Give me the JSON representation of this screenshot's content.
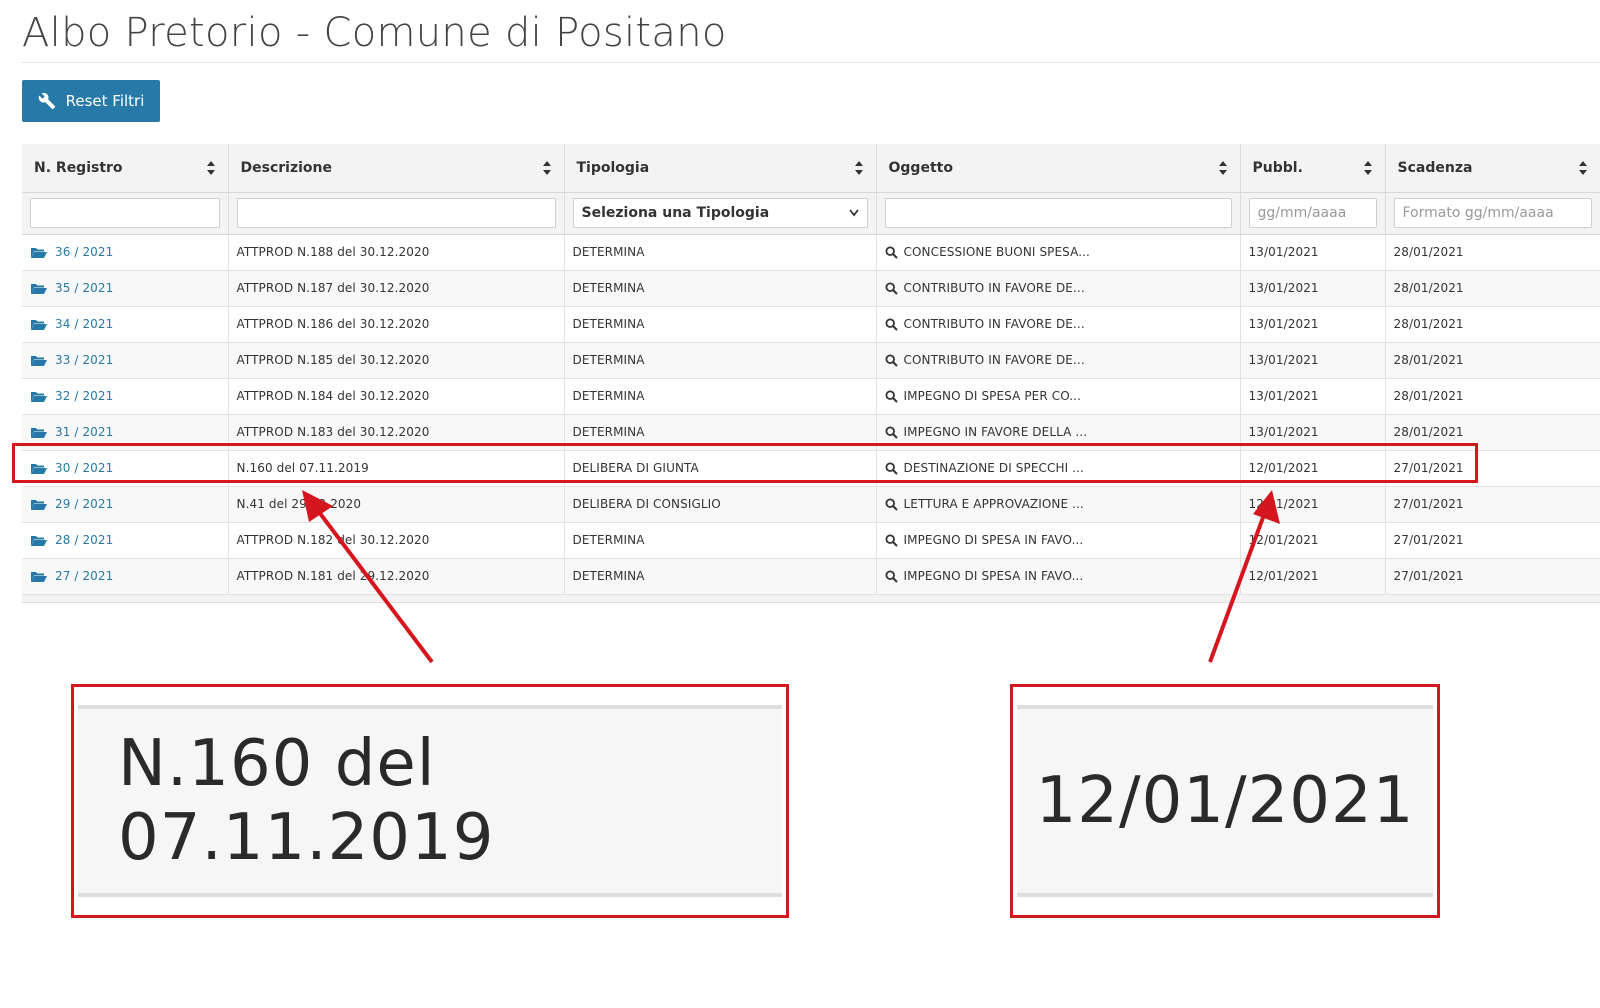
{
  "page": {
    "title": "Albo Pretorio - Comune di Positano"
  },
  "toolbar": {
    "reset_label": "Reset Filtri",
    "reset_icon": "wrench-icon"
  },
  "table": {
    "headers": [
      "N. Registro",
      "Descrizione",
      "Tipologia",
      "Oggetto",
      "Pubbl.",
      "Scadenza"
    ],
    "filters": {
      "tipologia_selected": "Seleziona una Tipologia",
      "pubbl_placeholder": "gg/mm/aaaa",
      "scadenza_placeholder": "Formato gg/mm/aaaa"
    },
    "rows": [
      {
        "registro": "36 / 2021",
        "descrizione": "ATTPROD N.188 del 30.12.2020",
        "tipologia": "DETERMINA",
        "oggetto": "CONCESSIONE BUONI SPESA...",
        "pubbl": "13/01/2021",
        "scadenza": "28/01/2021"
      },
      {
        "registro": "35 / 2021",
        "descrizione": "ATTPROD N.187 del 30.12.2020",
        "tipologia": "DETERMINA",
        "oggetto": "CONTRIBUTO IN FAVORE DE...",
        "pubbl": "13/01/2021",
        "scadenza": "28/01/2021"
      },
      {
        "registro": "34 / 2021",
        "descrizione": "ATTPROD N.186 del 30.12.2020",
        "tipologia": "DETERMINA",
        "oggetto": "CONTRIBUTO IN FAVORE DE...",
        "pubbl": "13/01/2021",
        "scadenza": "28/01/2021"
      },
      {
        "registro": "33 / 2021",
        "descrizione": "ATTPROD N.185 del 30.12.2020",
        "tipologia": "DETERMINA",
        "oggetto": "CONTRIBUTO IN FAVORE DE...",
        "pubbl": "13/01/2021",
        "scadenza": "28/01/2021"
      },
      {
        "registro": "32 / 2021",
        "descrizione": "ATTPROD N.184 del 30.12.2020",
        "tipologia": "DETERMINA",
        "oggetto": "IMPEGNO DI SPESA PER CO...",
        "pubbl": "13/01/2021",
        "scadenza": "28/01/2021"
      },
      {
        "registro": "31 / 2021",
        "descrizione": "ATTPROD N.183 del 30.12.2020",
        "tipologia": "DETERMINA",
        "oggetto": "IMPEGNO IN FAVORE DELLA ...",
        "pubbl": "13/01/2021",
        "scadenza": "28/01/2021"
      },
      {
        "registro": "30 / 2021",
        "descrizione": "N.160 del 07.11.2019",
        "tipologia": "DELIBERA DI GIUNTA",
        "oggetto": "DESTINAZIONE DI SPECCHI ...",
        "pubbl": "12/01/2021",
        "scadenza": "27/01/2021"
      },
      {
        "registro": "29 / 2021",
        "descrizione": "N.41 del 29.12.2020",
        "tipologia": "DELIBERA DI CONSIGLIO",
        "oggetto": "LETTURA E APPROVAZIONE ...",
        "pubbl": "12/01/2021",
        "scadenza": "27/01/2021"
      },
      {
        "registro": "28 / 2021",
        "descrizione": "ATTPROD N.182 del 30.12.2020",
        "tipologia": "DETERMINA",
        "oggetto": "IMPEGNO DI SPESA IN FAVO...",
        "pubbl": "12/01/2021",
        "scadenza": "27/01/2021"
      },
      {
        "registro": "27 / 2021",
        "descrizione": "ATTPROD N.181 del 29.12.2020",
        "tipologia": "DETERMINA",
        "oggetto": "IMPEGNO DI SPESA IN FAVO...",
        "pubbl": "12/01/2021",
        "scadenza": "27/01/2021"
      }
    ]
  },
  "annotations": {
    "zoom_descrizione": "N.160 del 07.11.2019",
    "zoom_pubbl": "12/01/2021",
    "highlight_color": "#d6161e"
  },
  "colors": {
    "accent": "#2779a7",
    "highlight": "#d6161e"
  }
}
